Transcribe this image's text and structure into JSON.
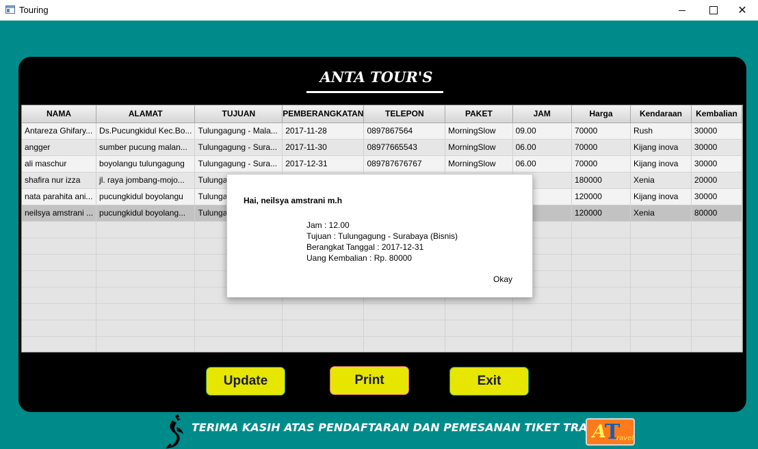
{
  "window": {
    "title": "Touring"
  },
  "header": {
    "title": "ANTA TOUR'S"
  },
  "table": {
    "columns": [
      "NAMA",
      "ALAMAT",
      "TUJUAN",
      "PEMBERANGKATAN",
      "TELEPON",
      "PAKET",
      "JAM",
      "Harga",
      "Kendaraan",
      "Kembalian"
    ],
    "rows": [
      [
        "Antareza Ghifary...",
        "Ds.Pucungkidul Kec.Bo...",
        "Tulungagung - Mala...",
        "2017-11-28",
        "0897867564",
        "MorningSlow",
        "09.00",
        "70000",
        "Rush",
        "30000"
      ],
      [
        "angger",
        "sumber pucung malan...",
        "Tulungagung - Sura...",
        "2017-11-30",
        "08977665543",
        "MorningSlow",
        "06.00",
        "70000",
        "Kijang inova",
        "30000"
      ],
      [
        "ali maschur",
        "boyolangu tulungagung",
        "Tulungagung - Sura...",
        "2017-12-31",
        "089787676767",
        "MorningSlow",
        "06.00",
        "70000",
        "Kijang inova",
        "30000"
      ],
      [
        "shafira nur izza",
        "jl. raya jombang-mojo...",
        "Tulungagu",
        "",
        "",
        "",
        "",
        "180000",
        "Xenia",
        "20000"
      ],
      [
        "nata parahita ani...",
        "pucungkidul boyolangu",
        "Tulungagu",
        "",
        "",
        "",
        "",
        "120000",
        "Kijang inova",
        "30000"
      ],
      [
        "neilsya amstrani ...",
        "pucungkidul boyolang...",
        "Tulungagu",
        "",
        "",
        "",
        "",
        "120000",
        "Xenia",
        "80000"
      ]
    ],
    "selected_row": 5,
    "empty_rows": 8
  },
  "buttons": {
    "update": "Update",
    "print": "Print",
    "exit": "Exit"
  },
  "footer": {
    "text": "TERIMA KASIH ATAS PENDAFTARAN DAN PEMESANAN TIKET TRAVEL",
    "logo_text": "ATravel"
  },
  "dialog": {
    "greeting": "Hai, neilsya amstrani m.h",
    "lines": [
      "Jam : 12.00",
      "Tujuan : Tulungagung - Surabaya (Bisnis)",
      "Berangkat Tanggal : 2017-12-31",
      "Uang Kembalian : Rp. 80000"
    ],
    "ok_label": "Okay"
  },
  "colors": {
    "background": "#008b8b",
    "panel": "#000000",
    "button": "#e6e600",
    "logo": "#ff7a1a"
  },
  "icons": [
    "app-icon",
    "minimize-icon",
    "maximize-icon",
    "close-icon",
    "mascot-icon"
  ]
}
